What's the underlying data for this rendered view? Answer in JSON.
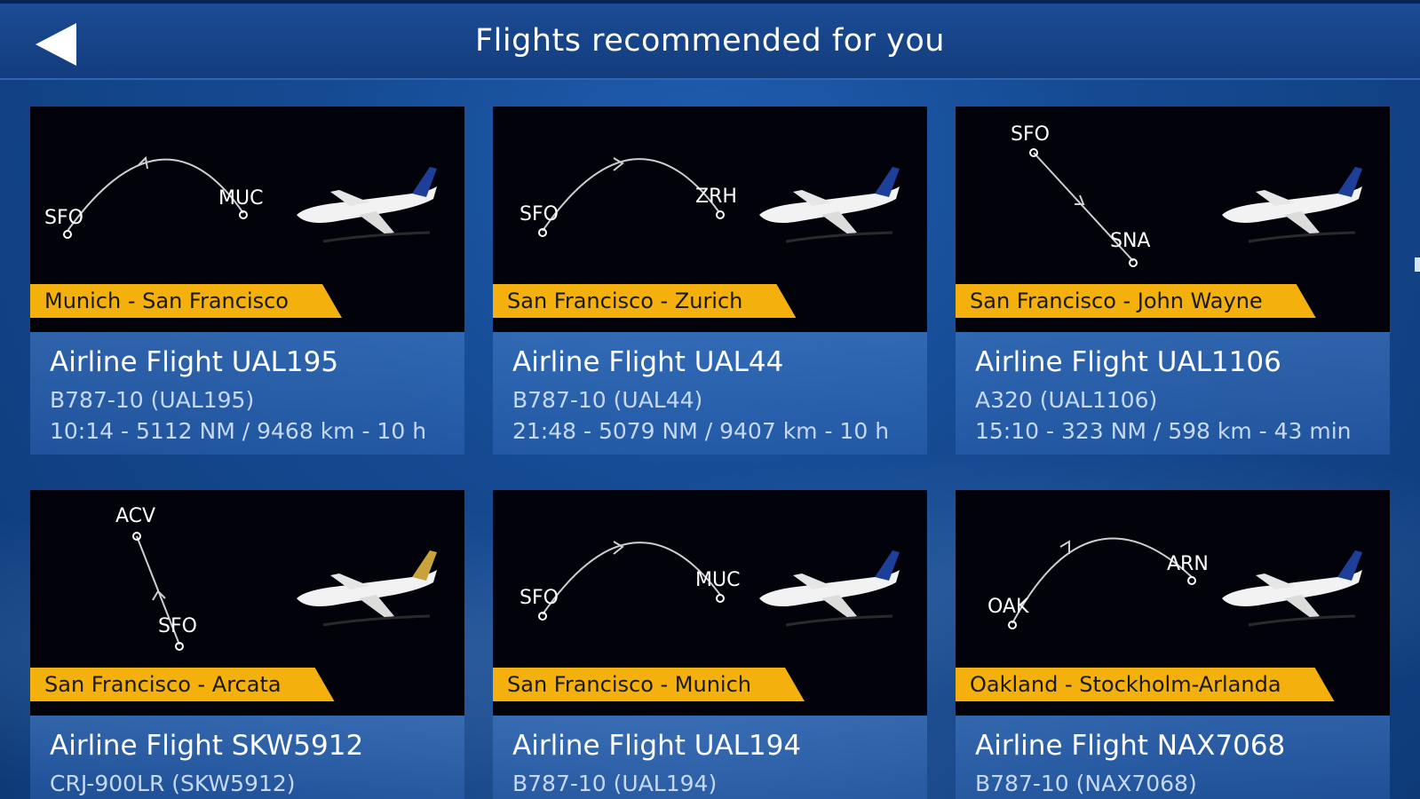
{
  "header": {
    "title": "Flights recommended for you"
  },
  "cards": [
    {
      "route": "Munich - San Francisco",
      "flight": "Airline Flight UAL195",
      "aircraft": "B787-10 (UAL195)",
      "details": "10:14 - 5112 NM / 9468 km - 10 h",
      "map": {
        "from": "SFO",
        "to": "MUC"
      }
    },
    {
      "route": "San Francisco - Zurich",
      "flight": "Airline Flight UAL44",
      "aircraft": "B787-10 (UAL44)",
      "details": "21:48 - 5079 NM / 9407 km - 10 h",
      "map": {
        "from": "SFO",
        "to": "ZRH"
      }
    },
    {
      "route": "San Francisco - John Wayne",
      "flight": "Airline Flight UAL1106",
      "aircraft": "A320 (UAL1106)",
      "details": "15:10 - 323 NM / 598 km - 43 min",
      "map": {
        "from": "SFO",
        "to": "SNA"
      }
    },
    {
      "route": "San Francisco - Arcata",
      "flight": "Airline Flight SKW5912",
      "aircraft": "CRJ-900LR (SKW5912)",
      "details": "",
      "map": {
        "from": "ACV",
        "to": "SFO"
      }
    },
    {
      "route": "San Francisco - Munich",
      "flight": "Airline Flight UAL194",
      "aircraft": "B787-10 (UAL194)",
      "details": "",
      "map": {
        "from": "SFO",
        "to": "MUC"
      }
    },
    {
      "route": "Oakland - Stockholm-Arlanda",
      "flight": "Airline Flight NAX7068",
      "aircraft": "B787-10 (NAX7068)",
      "details": "",
      "map": {
        "from": "OAK",
        "to": "ARN"
      }
    }
  ],
  "colors": {
    "route_tag": "#f4b00c",
    "background": "#154a92",
    "card_image_bg": "#02030a"
  },
  "icons": {
    "back": "back-arrow-icon",
    "aircraft": "airliner-icon"
  }
}
